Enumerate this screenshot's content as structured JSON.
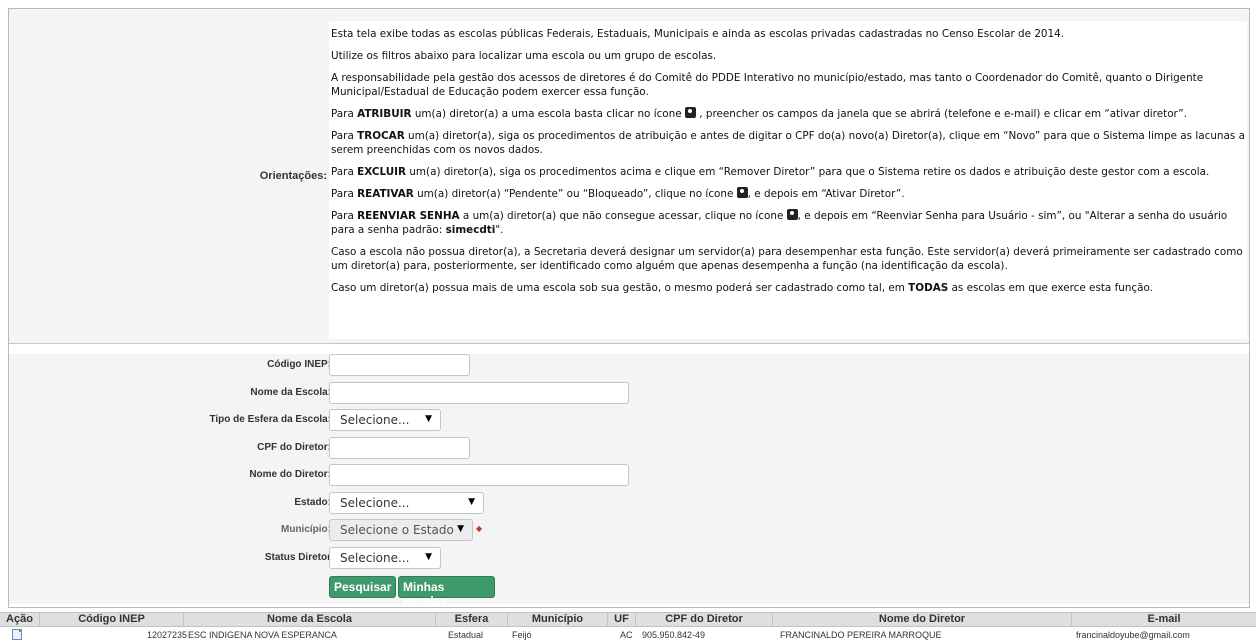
{
  "orientacoes": {
    "label": "Orientações:",
    "p1": "Esta tela exibe todas as escolas públicas Federais, Estaduais, Municipais e ainda as escolas privadas cadastradas no Censo Escolar de 2014.",
    "p2": "Utilize os filtros abaixo para localizar uma escola ou um grupo de escolas.",
    "p3": "A responsabilidade pela gestão dos acessos de diretores é do Comitê do PDDE Interativo no município/estado, mas tanto o Coordenador do Comitê, quanto o Dirigente Municipal/Estadual de Educação podem exercer essa função.",
    "p4_pre": "Para ",
    "p4_kw": "ATRIBUIR",
    "p4_mid": " um(a) diretor(a) a uma escola basta clicar no ícone ",
    "p4_post": " , preencher os campos da janela que se abrirá (telefone e e-mail) e clicar em “ativar diretor”.",
    "p5_pre": "Para ",
    "p5_kw": "TROCAR",
    "p5_post": " um(a) diretor(a), siga os procedimentos de atribuição e antes de digitar o CPF do(a) novo(a) Diretor(a), clique em “Novo” para que o Sistema limpe as lacunas a serem preenchidas com os novos dados.",
    "p6_pre": "Para ",
    "p6_kw": "EXCLUIR",
    "p6_post": " um(a) diretor(a), siga os procedimentos acima e clique em “Remover Diretor” para que o Sistema retire os dados e atribuição deste gestor com a escola.",
    "p7_pre": "Para ",
    "p7_kw": "REATIVAR",
    "p7_mid": " um(a) diretor(a) “Pendente” ou “Bloqueado”, clique no ícone ",
    "p7_post": ", e depois em “Ativar Diretor”.",
    "p8_pre": "Para ",
    "p8_kw": "REENVIAR SENHA",
    "p8_mid": " a um(a) diretor(a) que não consegue acessar, clique no ícone ",
    "p8_post": ", e depois em “Reenviar Senha para Usuário - sim”, ou \"Alterar a senha do usuário para a senha padrão: ",
    "p8_kw2": "simecdti",
    "p8_end": "\".",
    "p9": "Caso a escola não possua diretor(a), a Secretaria deverá designar um servidor(a) para desempenhar esta função. Este servidor(a) deverá primeiramente ser cadastrado como um diretor(a) para, posteriormente, ser identificado como alguém que apenas desempenha a função (na identificação da escola).",
    "p10_pre": "Caso um diretor(a) possua mais de uma escola sob sua gestão, o mesmo poderá ser cadastrado como tal, em ",
    "p10_kw": "TODAS",
    "p10_post": " as escolas em que exerce esta função."
  },
  "form": {
    "codigo_inep_label": "Código INEP:",
    "codigo_inep_value": "",
    "nome_escola_label": "Nome da Escola:",
    "nome_escola_value": "",
    "tipo_esfera_label": "Tipo de Esfera da Escola:",
    "tipo_esfera_value": "Selecione...",
    "cpf_diretor_label": "CPF do Diretor:",
    "cpf_diretor_value": "",
    "nome_diretor_label": "Nome do Diretor:",
    "nome_diretor_value": "",
    "estado_label": "Estado:",
    "estado_value": "Selecione...",
    "municipio_label": "Município:",
    "municipio_value": "Selecione o Estado",
    "status_label": "Status Diretor",
    "status_value": "Selecione...",
    "pesquisar_label": "Pesquisar",
    "minhas_escolas_label": "Minhas escolas"
  },
  "table": {
    "headers": [
      "Ação",
      "Código INEP",
      "Nome da Escola",
      "Esfera",
      "Município",
      "UF",
      "CPF do Diretor",
      "Nome do Diretor",
      "E-mail"
    ],
    "rows": [
      {
        "codigo_inep": "12027235",
        "nome_escola": "ESC INDIGENA NOVA ESPERANCA",
        "esfera": "Estadual",
        "municipio": "Feijó",
        "uf": "AC",
        "cpf": "905.950.842-49",
        "nome_diretor": "FRANCINALDO PEREIRA MARROQUE",
        "email": "francinaldoyube@gmail.com"
      }
    ]
  },
  "icons": {
    "person_icon": "person-icon",
    "edit_icon": "document-edit-icon"
  }
}
